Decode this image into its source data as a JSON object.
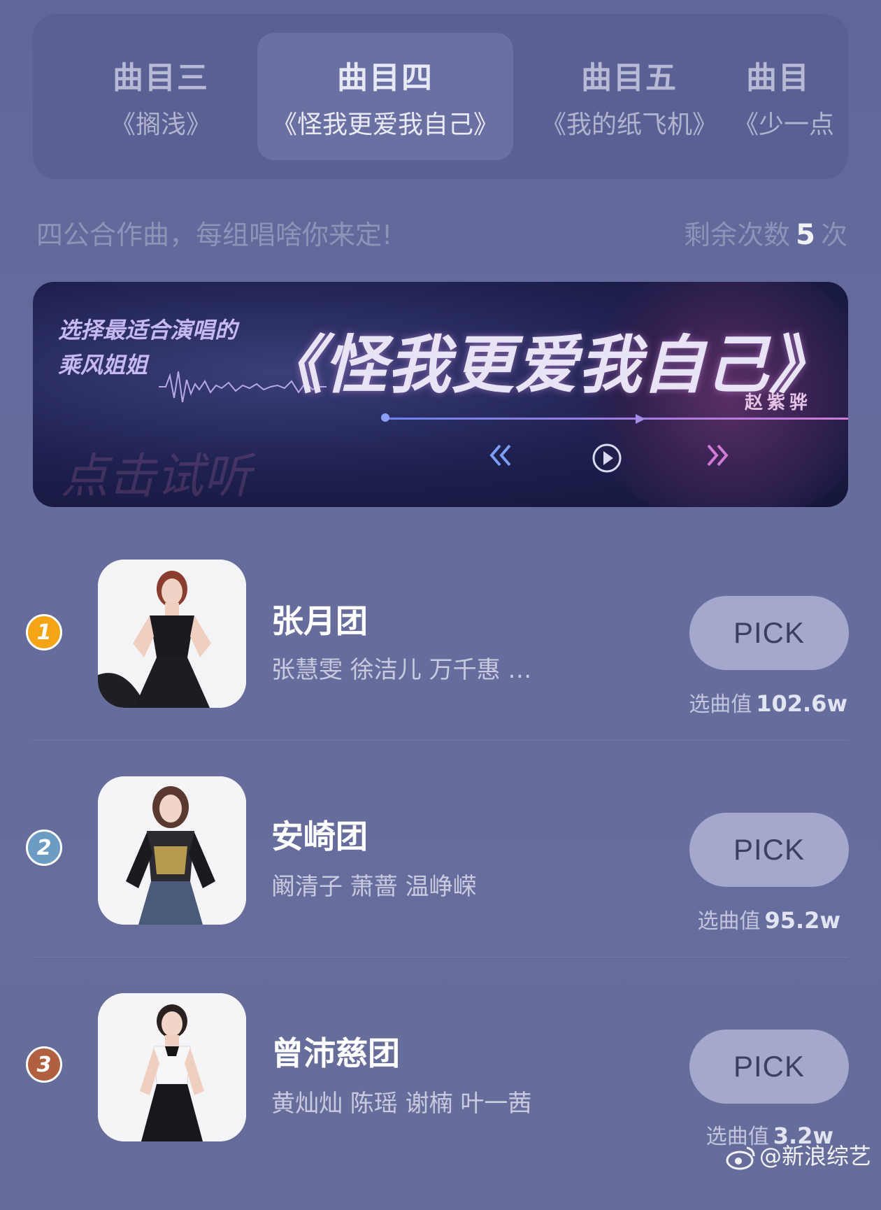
{
  "tabs": [
    {
      "title": "曲目三",
      "song": "《搁浅》"
    },
    {
      "title": "曲目四",
      "song": "《怪我更爱我自己》"
    },
    {
      "title": "曲目五",
      "song": "《我的纸飞机》"
    },
    {
      "title": "曲目",
      "song": "《少一点"
    }
  ],
  "subtitle": "四公合作曲，每组唱啥你来定!",
  "remaining": {
    "prefix": "剩余次数",
    "count": "5",
    "suffix": "次"
  },
  "banner": {
    "tag_line1": "选择最适合演唱的",
    "tag_line2": "乘风姐姐",
    "song": "《怪我更爱我自己》",
    "artist": "赵紫骅",
    "listen": "点击试听",
    "icons": [
      "prev-icon",
      "play-icon",
      "next-icon"
    ]
  },
  "groups": [
    {
      "rank": "1",
      "rank_color": "#f5a416",
      "name": "张月团",
      "members": "张慧雯 徐洁儿 万千惠 …",
      "pick": "PICK",
      "score_label": "选曲值",
      "score": "102.6w"
    },
    {
      "rank": "2",
      "rank_color": "#6c9bc4",
      "name": "安崎团",
      "members": "阚清子 萧蔷 温峥嵘",
      "pick": "PICK",
      "score_label": "选曲值",
      "score": "95.2w"
    },
    {
      "rank": "3",
      "rank_color": "#b0603e",
      "name": "曾沛慈团",
      "members": "黄灿灿 陈瑶 谢楠 叶一茜",
      "pick": "PICK",
      "score_label": "选曲值",
      "score": "3.2w"
    }
  ],
  "watermark": "@新浪综艺"
}
